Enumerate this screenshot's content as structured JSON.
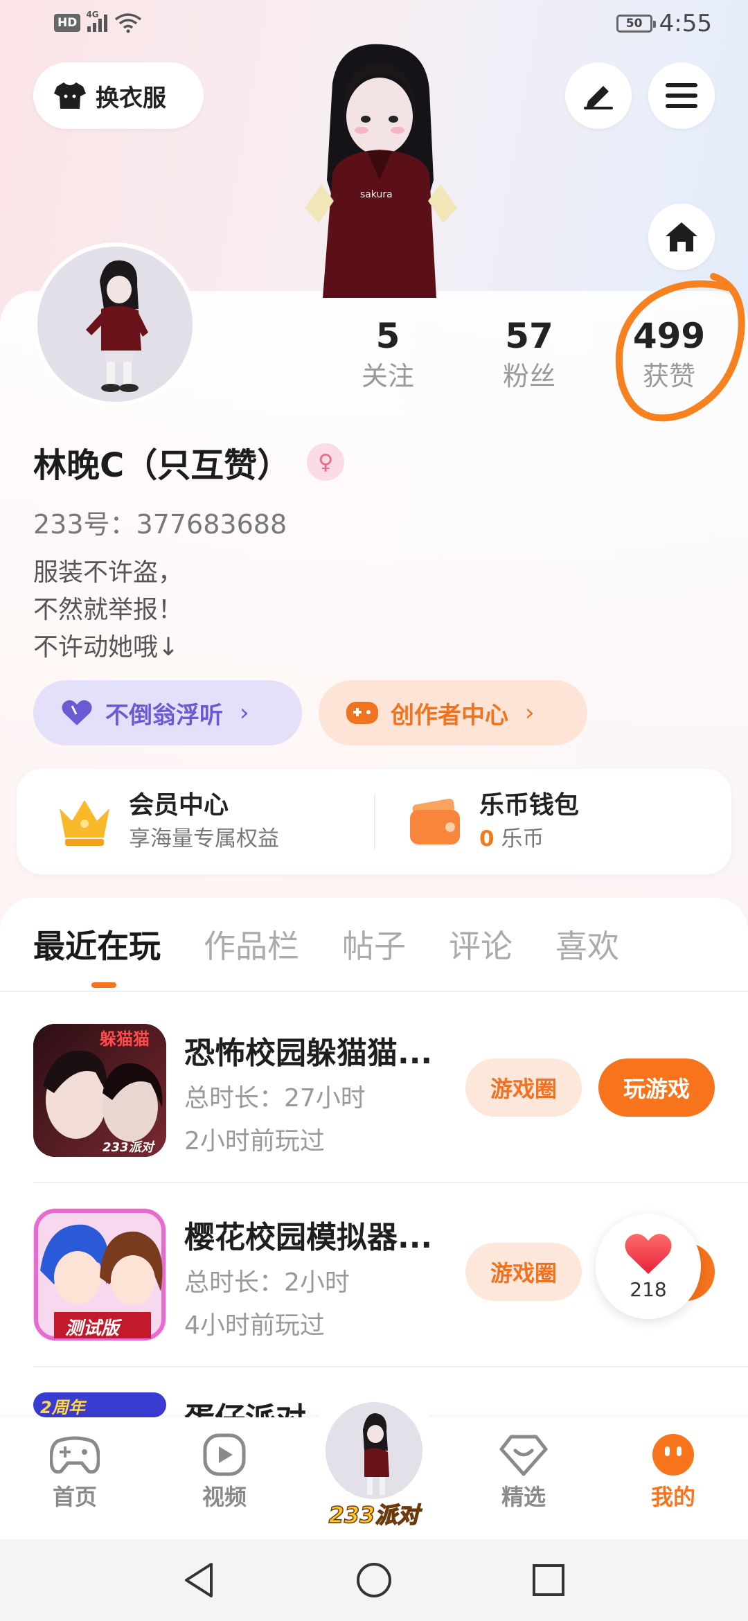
{
  "status_bar": {
    "hd": "HD",
    "network": "4G",
    "battery": "50",
    "time": "4:55"
  },
  "top": {
    "outfit_label": "换衣服",
    "edit_icon": "pen-icon",
    "menu_icon": "menu-icon",
    "home_icon": "home-icon"
  },
  "profile": {
    "stats": [
      {
        "value": "5",
        "label": "关注"
      },
      {
        "value": "57",
        "label": "粉丝"
      },
      {
        "value": "499",
        "label": "获赞"
      }
    ],
    "name": "林晚C（只互赞）",
    "gender_symbol": "♀",
    "uid": "233号：377683688",
    "bio": [
      "服装不许盗，",
      "不然就举报！",
      "不许动她哦↓"
    ]
  },
  "pills": {
    "music": "不倒翁浮听",
    "creator": "创作者中心",
    "chevron": "›"
  },
  "card": {
    "vip_title": "会员中心",
    "vip_sub": "享海量专属权益",
    "wallet_title": "乐币钱包",
    "wallet_amount": "0",
    "wallet_unit": "乐币"
  },
  "tabs": [
    "最近在玩",
    "作品栏",
    "帖子",
    "评论",
    "喜欢"
  ],
  "games": [
    {
      "title": "恐怖校园躲猫猫...",
      "duration": "总时长：27小时",
      "last_played": "2小时前玩过",
      "circle_btn": "游戏圈",
      "play_btn": "玩游戏",
      "thumb_text": "躲猫猫",
      "thumb_tag": "233派对"
    },
    {
      "title": "樱花校园模拟器...",
      "duration": "总时长：2小时",
      "last_played": "4小时前玩过",
      "circle_btn": "游戏圈",
      "thumb_tag": "测试版"
    },
    {
      "title": "蛋仔派对",
      "thumb_tag": "2周年"
    }
  ],
  "like_float": {
    "count": "218"
  },
  "bottom_nav": {
    "items": [
      "首页",
      "视频",
      "精选",
      "我的"
    ],
    "center_label": "233派对"
  },
  "colors": {
    "accent": "#f7731c",
    "purple": "#6a5bd4",
    "annotation": "#f7801f"
  }
}
